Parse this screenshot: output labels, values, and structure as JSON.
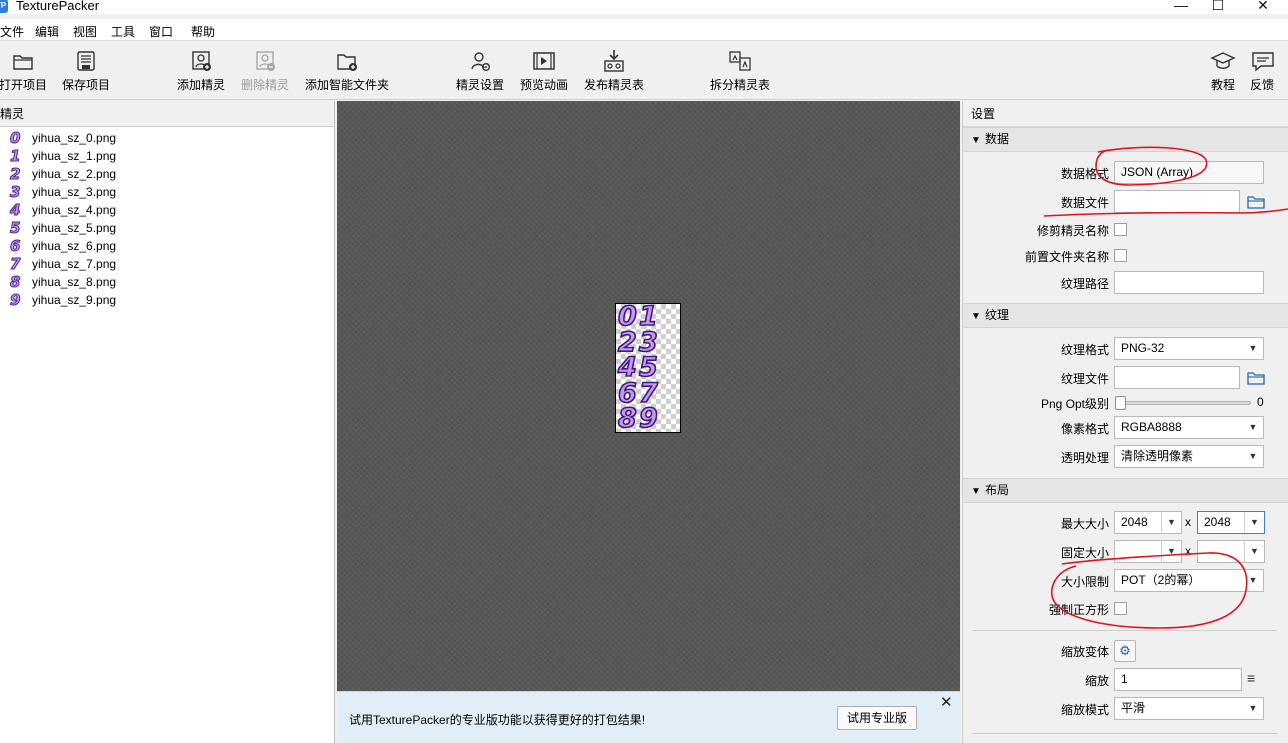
{
  "window": {
    "app_icon": "TP",
    "title": "TexturePacker",
    "minimize": "—",
    "maximize": "☐",
    "close": "✕"
  },
  "menu": [
    "文件",
    "编辑",
    "视图",
    "工具",
    "窗口",
    "帮助"
  ],
  "toolbar": {
    "open_project": "打开项目",
    "save_project": "保存项目",
    "add_sprites": "添加精灵",
    "remove_sprites": "删除精灵",
    "add_smart_folder": "添加智能文件夹",
    "sprite_settings": "精灵设置",
    "preview_animation": "预览动画",
    "publish_sprite_sheet": "发布精灵表",
    "split_sprite_sheet": "拆分精灵表",
    "tutorials": "教程",
    "feedback": "反馈"
  },
  "sprites_panel": {
    "title": "精灵",
    "items": [
      {
        "digit": "0",
        "name": "yihua_sz_0.png"
      },
      {
        "digit": "1",
        "name": "yihua_sz_1.png"
      },
      {
        "digit": "2",
        "name": "yihua_sz_2.png"
      },
      {
        "digit": "3",
        "name": "yihua_sz_3.png"
      },
      {
        "digit": "4",
        "name": "yihua_sz_4.png"
      },
      {
        "digit": "5",
        "name": "yihua_sz_5.png"
      },
      {
        "digit": "6",
        "name": "yihua_sz_6.png"
      },
      {
        "digit": "7",
        "name": "yihua_sz_7.png"
      },
      {
        "digit": "8",
        "name": "yihua_sz_8.png"
      },
      {
        "digit": "9",
        "name": "yihua_sz_9.png"
      }
    ]
  },
  "atlas_preview": {
    "rows": [
      [
        "0",
        "1"
      ],
      [
        "2",
        "3"
      ],
      [
        "4",
        "5"
      ],
      [
        "6",
        "7"
      ],
      [
        "8",
        "9"
      ]
    ]
  },
  "notice": {
    "text": "试用TexturePacker的专业版功能以获得更好的打包结果!",
    "button": "试用专业版",
    "close": "✕"
  },
  "settings": {
    "title": "设置",
    "data_section": {
      "title": "数据",
      "data_format_label": "数据格式",
      "data_format_value": "JSON (Array)",
      "data_file_label": "数据文件",
      "data_file_value": "",
      "trim_sprite_names_label": "修剪精灵名称",
      "prepend_folder_name_label": "前置文件夹名称",
      "texture_path_label": "纹理路径",
      "texture_path_value": ""
    },
    "texture_section": {
      "title": "纹理",
      "texture_format_label": "纹理格式",
      "texture_format_value": "PNG-32",
      "texture_file_label": "纹理文件",
      "texture_file_value": "",
      "png_opt_label": "Png Opt级别",
      "png_opt_value": "0",
      "pixel_format_label": "像素格式",
      "pixel_format_value": "RGBA8888",
      "alpha_handling_label": "透明处理",
      "alpha_handling_value": "清除透明像素"
    },
    "layout_section": {
      "title": "布局",
      "max_size_label": "最大大小",
      "max_width": "2048",
      "max_height": "2048",
      "times": "x",
      "fixed_size_label": "固定大小",
      "fixed_width": "",
      "fixed_height": "",
      "size_constraints_label": "大小限制",
      "size_constraints_value": "POT（2的幂）",
      "force_squared_label": "强制正方形",
      "scaling_variants_label": "缩放变体",
      "scale_label": "缩放",
      "scale_value": "1",
      "scale_mode_label": "缩放模式",
      "scale_mode_value": "平滑"
    }
  },
  "colors": {
    "annotation_red": "#e0141e",
    "sprite_fill": "#c89cf6",
    "sprite_outline": "#4a1e86",
    "canvas": "#575757",
    "notice_bg": "#e1eef8"
  }
}
